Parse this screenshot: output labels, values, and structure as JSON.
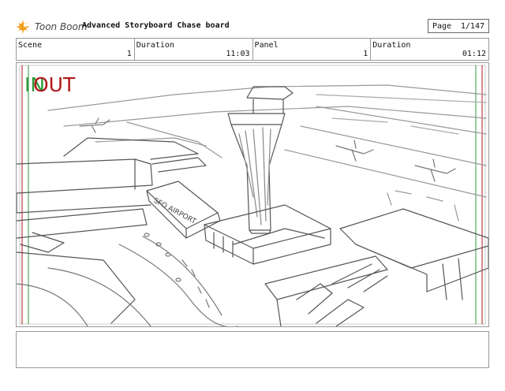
{
  "header": {
    "brand": "Toon Boom",
    "title": "Advanced Storyboard Chase board",
    "page_label": "Page",
    "page_value": "1/147"
  },
  "info": {
    "scene_label": "Scene",
    "scene_value": "1",
    "duration1_label": "Duration",
    "duration1_value": "11:03",
    "panel_label": "Panel",
    "panel_value": "1",
    "duration2_label": "Duration",
    "duration2_value": "01:12"
  },
  "panel": {
    "in_label": "IN",
    "out_label": "OUT",
    "sign_text": "SFO AIRPORT"
  },
  "notes": {
    "text": ""
  },
  "colors": {
    "in_green": "#2e9a3c",
    "out_red": "#b01818",
    "sketch": "#555555",
    "logo_orange": "#f0a020"
  }
}
